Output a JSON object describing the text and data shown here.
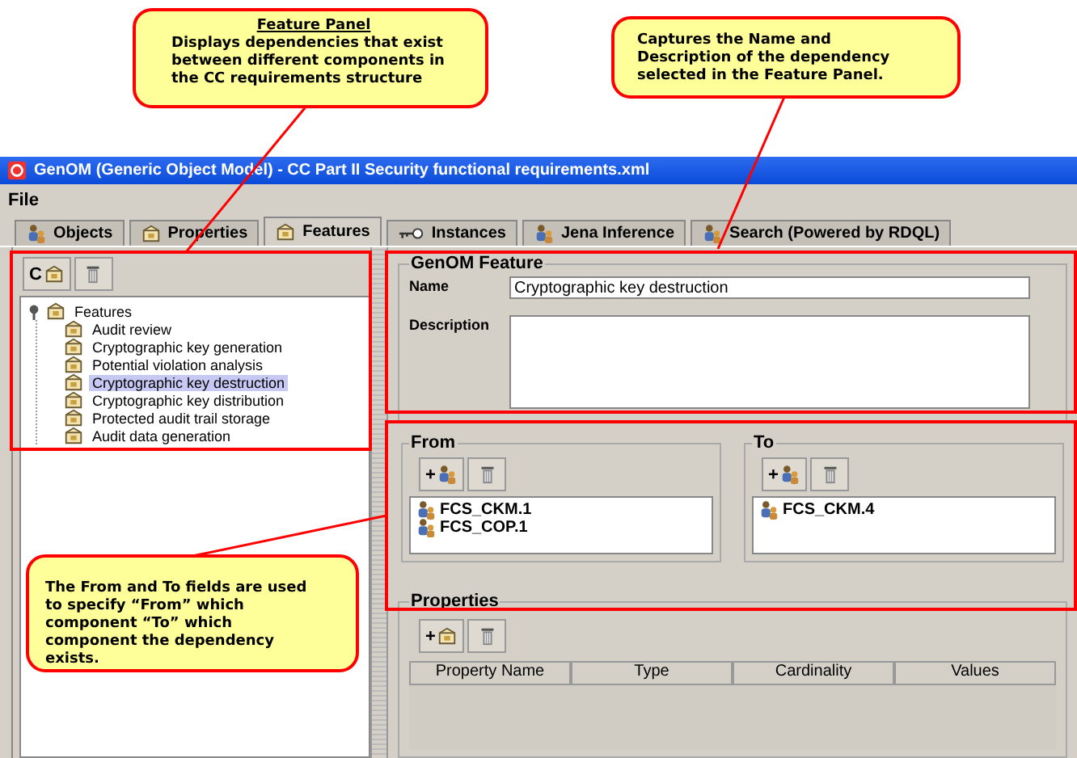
{
  "callouts": [
    {
      "title": "Feature Panel",
      "text": "Displays dependencies that exist between different components in the CC requirements structure"
    },
    {
      "text": "Captures the Name and Description of the dependency selected in the Feature Panel."
    },
    {
      "text": "The From and To fields are used to specify “From” which component “To” which component the dependency exists."
    }
  ],
  "window": {
    "title": "GenOM (Generic Object Model) - CC Part II Security functional requirements.xml"
  },
  "menu": [
    "File"
  ],
  "tabs": [
    {
      "label": "Objects",
      "selected": false
    },
    {
      "label": "Properties",
      "selected": false
    },
    {
      "label": "Features",
      "selected": true
    },
    {
      "label": "Instances",
      "selected": false
    },
    {
      "label": "Jena Inference",
      "selected": false
    },
    {
      "label": "Search (Powered by RDQL)",
      "selected": false
    }
  ],
  "toolbar_button": {
    "label": "C"
  },
  "tree": [
    {
      "label": "Features",
      "expanded": true,
      "selected": false,
      "children": [
        {
          "label": "Audit review",
          "selected": false
        },
        {
          "label": "Cryptographic key generation",
          "selected": false
        },
        {
          "label": "Potential violation analysis",
          "selected": false
        },
        {
          "label": "Cryptographic key destruction",
          "selected": true
        },
        {
          "label": "Cryptographic key distribution",
          "selected": false
        },
        {
          "label": "Protected audit trail storage",
          "selected": false
        },
        {
          "label": "Audit data generation",
          "selected": false
        }
      ]
    }
  ],
  "feature": {
    "title": "GenOM Feature",
    "name_label": "Name",
    "name_value": "Cryptographic key destruction",
    "description_label": "Description"
  },
  "from": {
    "title": "From",
    "add_label": "+",
    "items": [
      "FCS_CKM.1",
      "FCS_COP.1"
    ]
  },
  "to": {
    "title": "To",
    "add_label": "+",
    "items": [
      "FCS_CKM.4"
    ]
  },
  "properties": {
    "title": "Properties",
    "add_label": "+",
    "columns": [
      "Property Name",
      "Type",
      "Cardinality",
      "Values"
    ]
  }
}
